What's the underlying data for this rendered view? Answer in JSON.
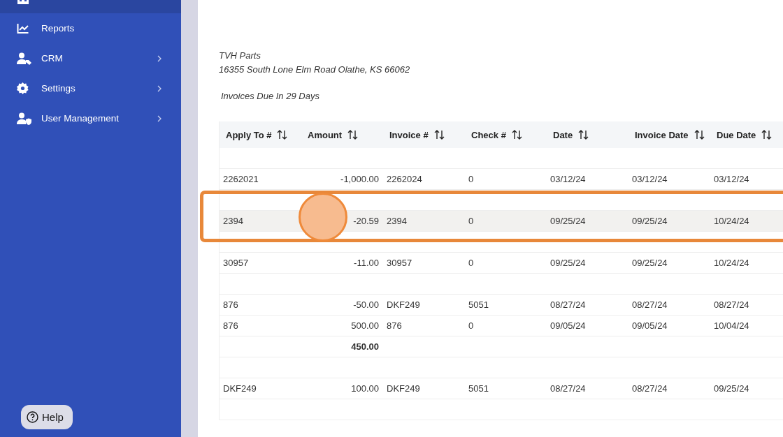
{
  "sidebar": {
    "items": [
      {
        "selected": true,
        "expandable": false
      },
      {
        "label": "Reports",
        "selected": false,
        "expandable": false
      },
      {
        "label": "CRM",
        "selected": false,
        "expandable": true
      },
      {
        "label": "Settings",
        "selected": false,
        "expandable": true
      },
      {
        "label": "User Management",
        "selected": false,
        "expandable": true
      }
    ],
    "help_button": "Help"
  },
  "report": {
    "company": "TVH Parts",
    "address": "16355 South Lone Elm Road Olathe, KS 66062",
    "subtitle": "Invoices Due In 29 Days",
    "table": {
      "columns": [
        "Apply To #",
        "Amount",
        "Invoice #",
        "Check #",
        "Date",
        "Invoice Date",
        "Due Date"
      ],
      "rows": [
        {
          "kind": "blank"
        },
        {
          "kind": "data",
          "hovered": false,
          "annotated": false,
          "cells": [
            "2262021",
            "-1,000.00",
            "2262024",
            "0",
            "03/12/24",
            "03/12/24",
            "03/12/24"
          ]
        },
        {
          "kind": "blank"
        },
        {
          "kind": "data",
          "hovered": true,
          "annotated": true,
          "cells": [
            "2394",
            "-20.59",
            "2394",
            "0",
            "09/25/24",
            "09/25/24",
            "10/24/24"
          ]
        },
        {
          "kind": "blank"
        },
        {
          "kind": "data",
          "hovered": false,
          "annotated": false,
          "cells": [
            "30957",
            "-11.00",
            "30957",
            "0",
            "09/25/24",
            "09/25/24",
            "10/24/24"
          ]
        },
        {
          "kind": "blank"
        },
        {
          "kind": "data",
          "hovered": false,
          "annotated": false,
          "cells": [
            "876",
            "-50.00",
            "DKF249",
            "5051",
            "08/27/24",
            "08/27/24",
            "08/27/24"
          ]
        },
        {
          "kind": "data",
          "hovered": false,
          "annotated": false,
          "cells": [
            "876",
            "500.00",
            "876",
            "0",
            "09/05/24",
            "09/05/24",
            "10/04/24"
          ]
        },
        {
          "kind": "total",
          "amount": "450.00"
        },
        {
          "kind": "blank"
        },
        {
          "kind": "data",
          "hovered": false,
          "annotated": false,
          "cells": [
            "DKF249",
            "100.00",
            "DKF249",
            "5051",
            "08/27/24",
            "08/27/24",
            "09/25/24"
          ]
        },
        {
          "kind": "blank"
        }
      ]
    }
  }
}
